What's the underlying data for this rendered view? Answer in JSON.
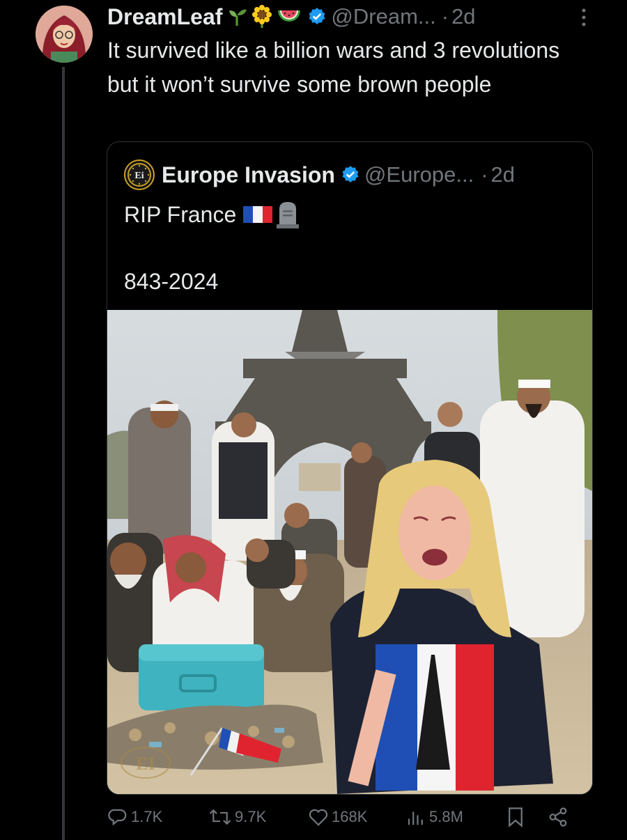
{
  "post": {
    "display_name": "DreamLeaf",
    "handle": "@Dream...",
    "separator": "·",
    "time": "2d",
    "text": "It survived like a billion wars and 3 revolutions but it won’t survive some brown people"
  },
  "quote": {
    "logo_text": "Ei",
    "display_name": "Europe Invasion",
    "handle": "@Europe...",
    "separator": "·",
    "time": "2d",
    "line1": "RIP France",
    "line2": "843-2024",
    "image_watermark": "EI"
  },
  "actions": {
    "replies": "1.7K",
    "reposts": "9.7K",
    "likes": "168K",
    "views": "5.8M"
  },
  "colors": {
    "background": "#000000",
    "text": "#e7e9ea",
    "muted": "#71767b",
    "verified": "#1d9bf0",
    "border": "#2f3336"
  },
  "icons": [
    "seedling-icon",
    "sunflower-icon",
    "watermelon-icon",
    "verified-icon",
    "more-icon",
    "french-flag-icon",
    "tombstone-icon",
    "reply-icon",
    "repost-icon",
    "like-icon",
    "views-icon",
    "bookmark-icon",
    "share-icon"
  ]
}
